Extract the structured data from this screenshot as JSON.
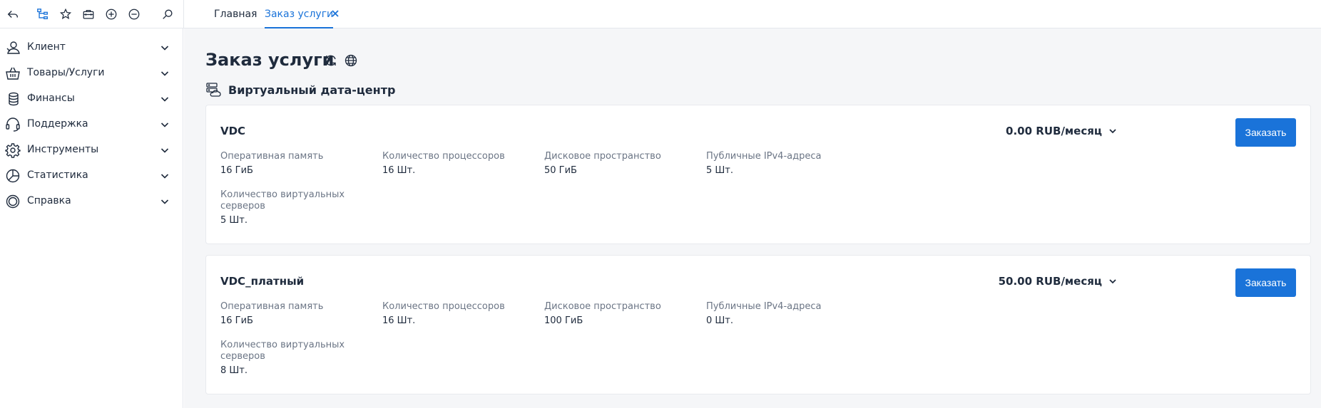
{
  "topbar": {
    "icons": [
      "back-icon",
      "sitemap-icon",
      "star-icon",
      "briefcase-icon",
      "plus-circle-icon",
      "minus-circle-icon",
      "search-icon"
    ],
    "tabs": [
      {
        "label": "Главная",
        "active": false
      },
      {
        "label": "Заказ услуги",
        "active": true
      }
    ]
  },
  "sidebar": {
    "items": [
      {
        "label": "Клиент",
        "icon": "user-icon"
      },
      {
        "label": "Товары/Услуги",
        "icon": "basket-icon"
      },
      {
        "label": "Финансы",
        "icon": "coins-icon"
      },
      {
        "label": "Поддержка",
        "icon": "headset-icon"
      },
      {
        "label": "Инструменты",
        "icon": "gear-icon"
      },
      {
        "label": "Статистика",
        "icon": "pie-chart-icon"
      },
      {
        "label": "Справка",
        "icon": "lifebuoy-icon"
      }
    ]
  },
  "main": {
    "title": "Заказ услуги",
    "section_title": "Виртуальный дата-центр",
    "order_label": "Заказать",
    "cards": [
      {
        "name": "VDC",
        "price": "0.00 RUB/месяц",
        "params": [
          {
            "label": "Оперативная память",
            "value": "16 ГиБ"
          },
          {
            "label": "Количество процессоров",
            "value": "16 Шт."
          },
          {
            "label": "Дисковое пространство",
            "value": "50 ГиБ"
          },
          {
            "label": "Публичные IPv4-адреса",
            "value": "5 Шт."
          },
          {
            "label": "Количество виртуальных серверов",
            "value": "5 Шт."
          }
        ]
      },
      {
        "name": "VDC_платный",
        "price": "50.00 RUB/месяц",
        "params": [
          {
            "label": "Оперативная память",
            "value": "16 ГиБ"
          },
          {
            "label": "Количество процессоров",
            "value": "16 Шт."
          },
          {
            "label": "Дисковое пространство",
            "value": "100 ГиБ"
          },
          {
            "label": "Публичные IPv4-адреса",
            "value": "0 Шт."
          },
          {
            "label": "Количество виртуальных серверов",
            "value": "8 Шт."
          }
        ]
      }
    ]
  },
  "colors": {
    "accent": "#1a73d9",
    "text": "#1f2b3d",
    "muted": "#6b7585",
    "background": "#f5f6f8"
  }
}
